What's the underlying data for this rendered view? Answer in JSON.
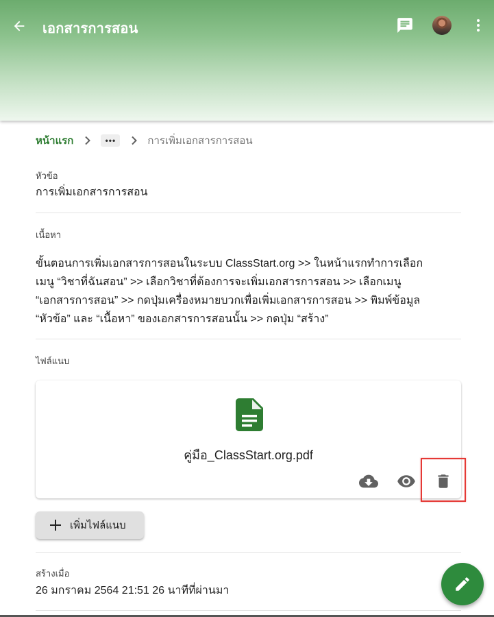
{
  "appbar": {
    "title": "เอกสารการสอน",
    "icons": {
      "back": "arrow-back-icon",
      "chat": "chat-icon",
      "more": "more-vert-icon"
    },
    "gradient_top": "#6cac6e"
  },
  "breadcrumb": {
    "home": "หน้าแรก",
    "more": "•••",
    "current": "การเพิ่มเอกสารการสอน"
  },
  "topic": {
    "label": "หัวข้อ",
    "value": "การเพิ่มเอกสารการสอน"
  },
  "content": {
    "label": "เนื้อหา",
    "lines": [
      "ขั้นตอนการเพิ่มเอกสารการสอนในระบบ ClassStart.org >> ในหน้าแรกทำการเลือก",
      "เมนู “วิชาที่ฉันสอน” >> เลือกวิชาที่ต้องการจะเพิ่มเอกสารการสอน >> เลือกเมนู",
      "“เอกสารการสอน” >> กดปุ่มเครื่องหมายบวกเพื่อเพิ่มเอกสารการสอน >> พิมพ์ข้อมูล",
      "“หัวข้อ” และ “เนื้อหา” ของเอกสารการสอนนั้น >> กดปุ่ม “สร้าง”"
    ]
  },
  "attachments": {
    "label": "ไฟล์แนบ",
    "file": {
      "name": "คู่มือ_ClassStart.org.pdf",
      "icon": "document-icon",
      "icon_color": "#2e7d32",
      "actions": [
        "download-icon",
        "view-icon",
        "delete-icon"
      ]
    },
    "add_button": "เพิ่มไฟล์แนบ",
    "highlight_color": "#e53935"
  },
  "created": {
    "label": "สร้างเมื่อ",
    "value": "26 มกราคม 2564 21:51 26 นาทีที่ผ่านมา"
  },
  "fab": {
    "icon": "edit-icon",
    "color": "#2e8b3d"
  }
}
